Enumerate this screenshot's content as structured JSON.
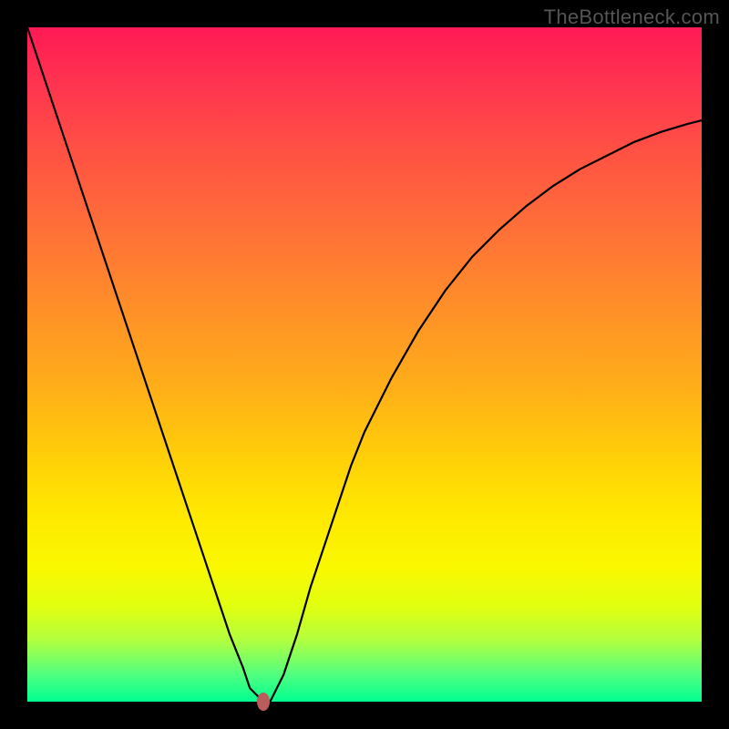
{
  "watermark": "TheBottleneck.com",
  "colors": {
    "background": "#000000",
    "curve": "#000000",
    "marker": "#b85c5c"
  },
  "chart_data": {
    "type": "line",
    "title": "",
    "xlabel": "",
    "ylabel": "",
    "xlim": [
      0,
      100
    ],
    "ylim": [
      0,
      100
    ],
    "grid": false,
    "legend": false,
    "x": [
      0,
      2,
      4,
      6,
      8,
      10,
      12,
      14,
      16,
      18,
      20,
      22,
      24,
      26,
      28,
      30,
      32,
      33,
      34,
      35,
      36,
      38,
      40,
      42,
      44,
      46,
      48,
      50,
      54,
      58,
      62,
      66,
      70,
      74,
      78,
      82,
      86,
      90,
      94,
      98,
      100
    ],
    "values": [
      100,
      94,
      88,
      82,
      76,
      70,
      64,
      58,
      52,
      46,
      40,
      34,
      28,
      22,
      16,
      10,
      5,
      2,
      1,
      0,
      0,
      4,
      10,
      17,
      23,
      29,
      35,
      40,
      48,
      55,
      61,
      66,
      70,
      73.5,
      76.5,
      79,
      81,
      83,
      84.5,
      85.7,
      86.2
    ],
    "marker": {
      "x": 35,
      "y": 0
    },
    "gradient_stops": [
      {
        "pos": 0,
        "color": "#ff1a55"
      },
      {
        "pos": 18,
        "color": "#ff5044"
      },
      {
        "pos": 42,
        "color": "#ff9028"
      },
      {
        "pos": 64,
        "color": "#ffd008"
      },
      {
        "pos": 80,
        "color": "#faf800"
      },
      {
        "pos": 96,
        "color": "#50ff80"
      },
      {
        "pos": 100,
        "color": "#00ff90"
      }
    ]
  }
}
